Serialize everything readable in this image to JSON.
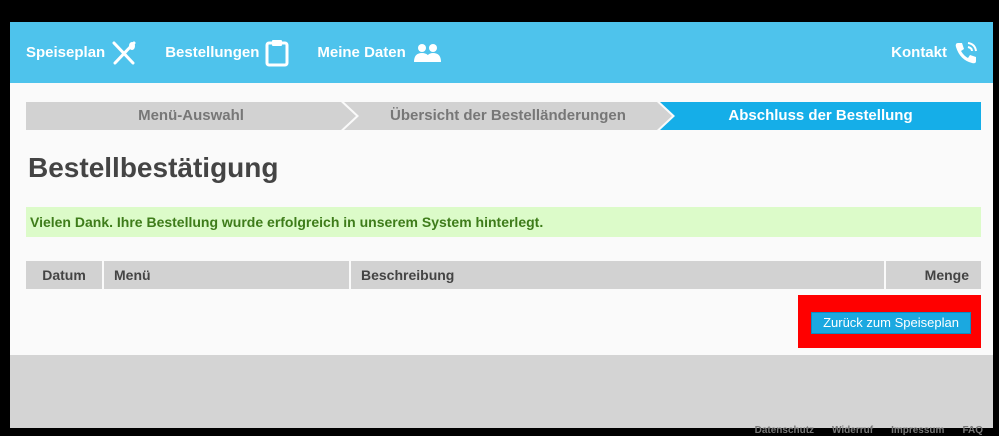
{
  "nav": {
    "speiseplan": "Speiseplan",
    "bestellungen": "Bestellungen",
    "meine_daten": "Meine Daten",
    "kontakt": "Kontakt"
  },
  "steps": [
    {
      "label": "Menü-Auswahl",
      "active": false
    },
    {
      "label": "Übersicht der Bestelländerungen",
      "active": false
    },
    {
      "label": "Abschluss der Bestellung",
      "active": true
    }
  ],
  "page_title": "Bestellbestätigung",
  "alert_message": "Vielen Dank. Ihre Bestellung wurde erfolgreich in unserem System hinterlegt.",
  "table": {
    "headers": [
      "Datum",
      "Menü",
      "Beschreibung",
      "Menge"
    ],
    "rows": []
  },
  "back_button": "Zurück zum Speiseplan",
  "footer_links": [
    "Datenschutz",
    "Widerruf",
    "Impressum",
    "FAQ"
  ],
  "colors": {
    "nav_bg": "#4ec3ec",
    "active_step": "#15aee8",
    "inactive_step": "#d2d2d2",
    "success_bg": "#dcfbc9",
    "success_text": "#3e7c1a",
    "highlight": "#ff0000"
  },
  "icons": {
    "speiseplan": "fork-knife-icon",
    "bestellungen": "clipboard-icon",
    "meine_daten": "users-icon",
    "kontakt": "phone-icon"
  }
}
